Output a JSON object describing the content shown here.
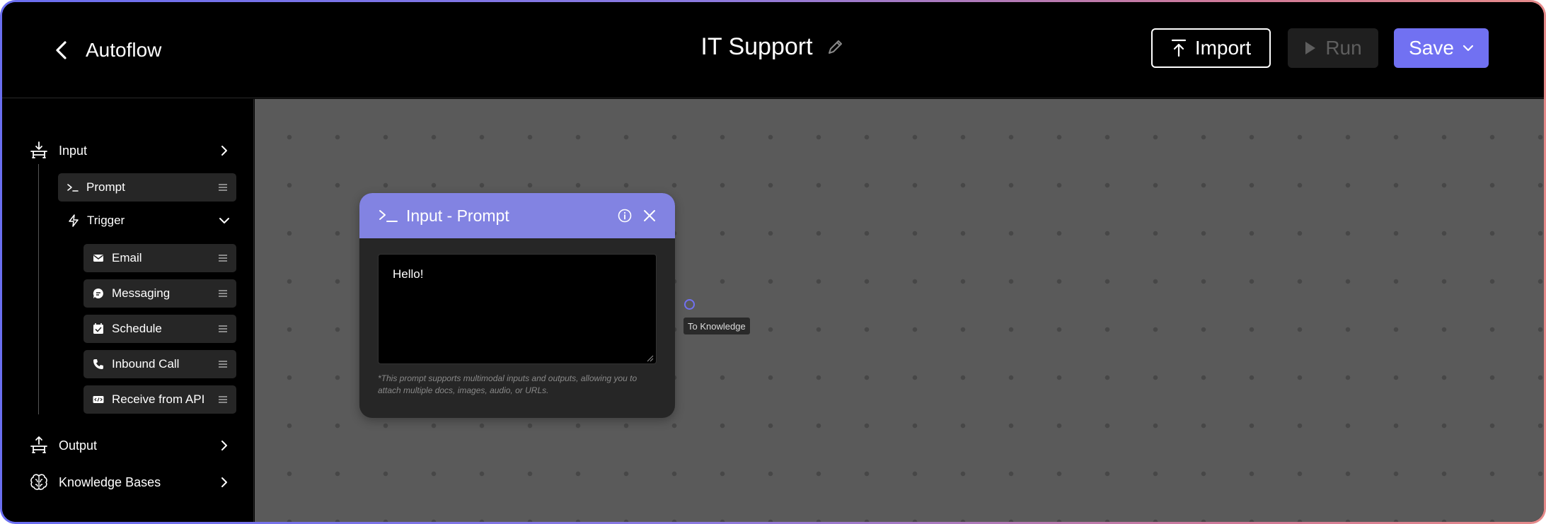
{
  "header": {
    "back_label": "Autoflow",
    "title": "IT Support",
    "import_label": "Import",
    "run_label": "Run",
    "save_label": "Save"
  },
  "sidebar": {
    "input_label": "Input",
    "prompt_label": "Prompt",
    "trigger_label": "Trigger",
    "trigger_items": [
      {
        "label": "Email",
        "icon": "mail-icon"
      },
      {
        "label": "Messaging",
        "icon": "chat-icon"
      },
      {
        "label": "Schedule",
        "icon": "calendar-check-icon"
      },
      {
        "label": "Inbound Call",
        "icon": "phone-icon"
      },
      {
        "label": "Receive from API",
        "icon": "api-icon"
      }
    ],
    "output_label": "Output",
    "knowledge_label": "Knowledge Bases"
  },
  "node": {
    "title": "Input - Prompt",
    "prompt_value": "Hello!",
    "note": "*This prompt supports multimodal inputs and outputs, allowing you to attach multiple docs, images, audio, or URLs.",
    "port_label": "To Knowledge"
  },
  "colors": {
    "accent": "#7171f2",
    "node_header": "#8283e2",
    "canvas": "#5a5a5a"
  }
}
